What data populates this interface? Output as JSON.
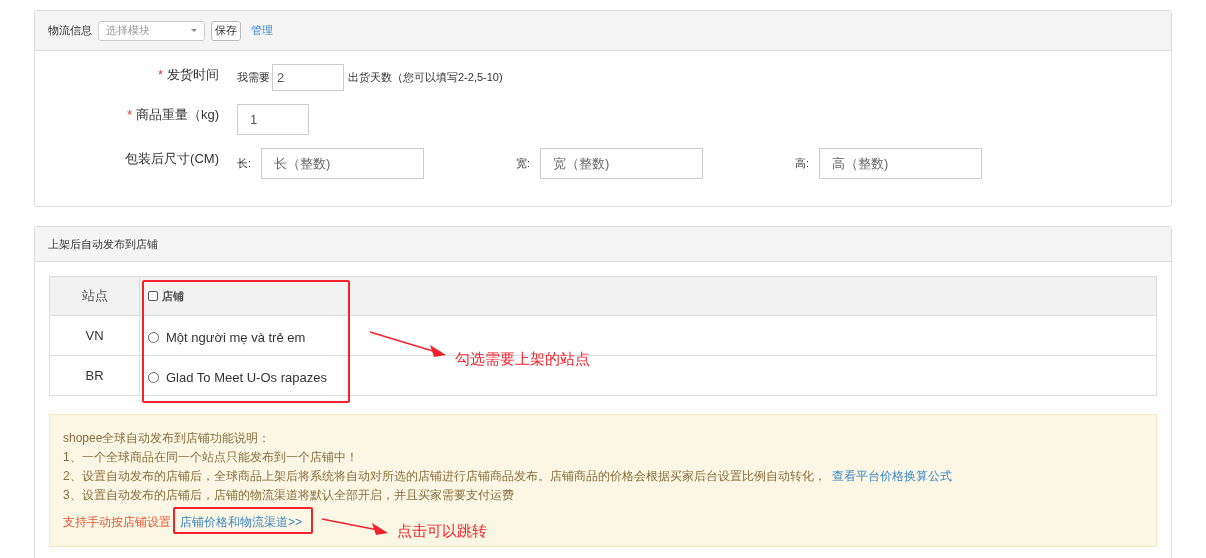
{
  "logistics": {
    "title": "物流信息",
    "template_select": {
      "placeholder": "选择模块"
    },
    "save_button": "保存",
    "manage_link": "管理",
    "ship_time": {
      "label": "发货时间",
      "required_mark": "*",
      "prefix": "我需要",
      "value": "2",
      "suffix": "出货天数（您可以填写2-2,5-10)"
    },
    "weight": {
      "label": "商品重量（kg)",
      "required_mark": "*",
      "value": "1"
    },
    "size": {
      "label": "包装后尺寸(CM)",
      "fields": [
        {
          "label": "长:",
          "placeholder": "长（整数)"
        },
        {
          "label": "宽:",
          "placeholder": "宽（整数)"
        },
        {
          "label": "高:",
          "placeholder": "高（整数)"
        }
      ]
    }
  },
  "auto_publish": {
    "title": "上架后自动发布到店铺",
    "table": {
      "columns": [
        "站点",
        "店铺"
      ],
      "select_all_checked": false,
      "rows": [
        {
          "site": "VN",
          "shop": "Một người mẹ và trẻ em",
          "selected": false
        },
        {
          "site": "BR",
          "shop": "Glad To Meet U-Os rapazes",
          "selected": false
        }
      ]
    },
    "notice": {
      "title": "shopee全球自动发布到店铺功能说明：",
      "lines": [
        {
          "text": "1、一个全球商品在同一个站点只能发布到一个店铺中！"
        },
        {
          "text": "2、设置自动发布的店铺后，全球商品上架后将系统将自动对所选的店铺进行店铺商品发布。店铺商品的价格会根据买家后台设置比例自动转化，",
          "link": "查看平台价格换算公式"
        },
        {
          "text": "3、设置自动发布的店铺后，店铺的物流渠道将默认全部开启，并且买家需要支付运费"
        }
      ],
      "footer": {
        "text": "支持手动按店铺设置",
        "link": "店铺价格和物流渠道>>"
      }
    }
  },
  "annotations": [
    {
      "text": "勾选需要上架的站点"
    },
    {
      "text": "点击可以跳转"
    }
  ]
}
